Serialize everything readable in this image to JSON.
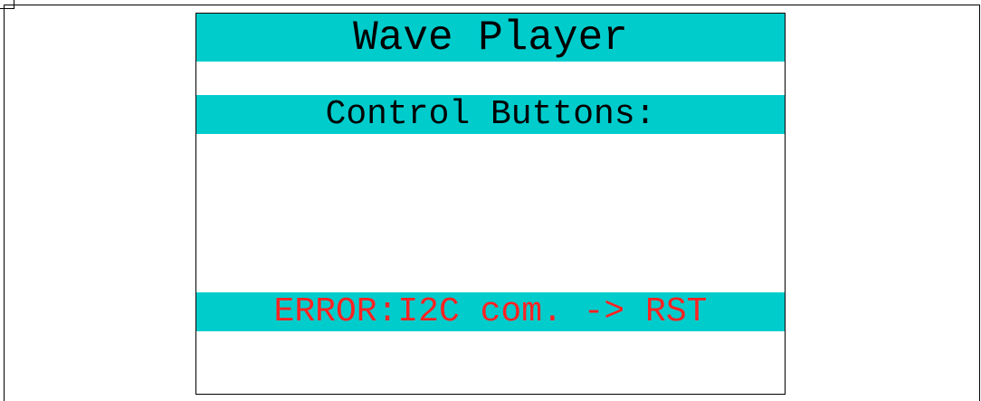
{
  "screen": {
    "title": "Wave Player",
    "section_label": "Control Buttons:",
    "error_message": "ERROR:I2C com. -> RST"
  },
  "colors": {
    "band_background": "#00cccc",
    "title_text": "#000000",
    "error_text": "#ff2222",
    "lcd_background": "#ffffff"
  }
}
